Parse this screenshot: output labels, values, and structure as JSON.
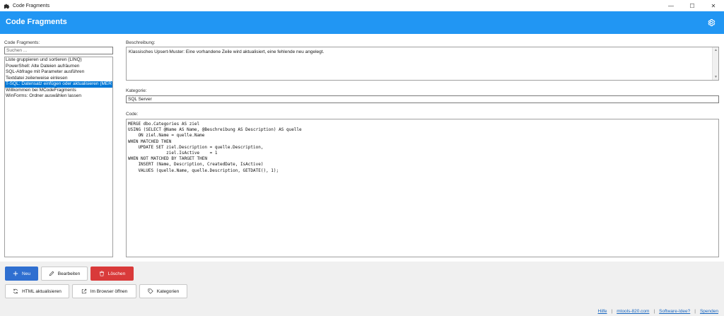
{
  "window": {
    "title": "Code Fragments",
    "minimize": "—",
    "maximize": "☐",
    "close": "✕"
  },
  "header": {
    "app_title": "Code Fragments"
  },
  "sidebar": {
    "label": "Code Fragments:",
    "search_placeholder": "Suchen ...",
    "items": [
      {
        "label": "Liste gruppieren und sortieren (LINQ)",
        "selected": false
      },
      {
        "label": "PowerShell: Alte Dateien aufräumen",
        "selected": false
      },
      {
        "label": "SQL-Abfrage mit Parameter ausführen",
        "selected": false
      },
      {
        "label": "Textdatei zeilenweise einlesen",
        "selected": false
      },
      {
        "label": "T-SQL: Datensatz einfügen oder aktualisieren (MER",
        "selected": true
      },
      {
        "label": "Willkommen bei MCodeFragments",
        "selected": false
      },
      {
        "label": "WinForms: Ordner auswählen lassen",
        "selected": false
      }
    ]
  },
  "detail": {
    "desc_label": "Beschreibung:",
    "description": "Klassisches Upsert-Muster: Eine vorhandene Zeile wird aktualisiert, eine fehlende neu angelegt.",
    "cat_label": "Kategorie:",
    "category": "SQL Server",
    "code_label": "Code:",
    "code": "MERGE dbo.Categories AS ziel\nUSING (SELECT @Name AS Name, @Beschreibung AS Description) AS quelle\n    ON ziel.Name = quelle.Name\nWHEN MATCHED THEN\n    UPDATE SET ziel.Description = quelle.Description,\n               ziel.IsActive    = 1\nWHEN NOT MATCHED BY TARGET THEN\n    INSERT (Name, Description, CreatedDate, IsActive)\n    VALUES (quelle.Name, quelle.Description, GETDATE(), 1);"
  },
  "buttons": {
    "new": "Neu",
    "edit": "Bearbeiten",
    "delete": "Löschen",
    "refresh_html": "HTML aktualisieren",
    "open_browser": "Im Browser öffnen",
    "categories": "Kategorien"
  },
  "footer": {
    "help": "Hilfe",
    "site": "mtools-820.com",
    "idea": "Software-Idee?",
    "donate": "Spenden",
    "sep": "|"
  },
  "colors": {
    "accent": "#2196f3",
    "primary_button": "#2f6fd0",
    "danger_button": "#d93a3a",
    "selection": "#0078d7"
  }
}
